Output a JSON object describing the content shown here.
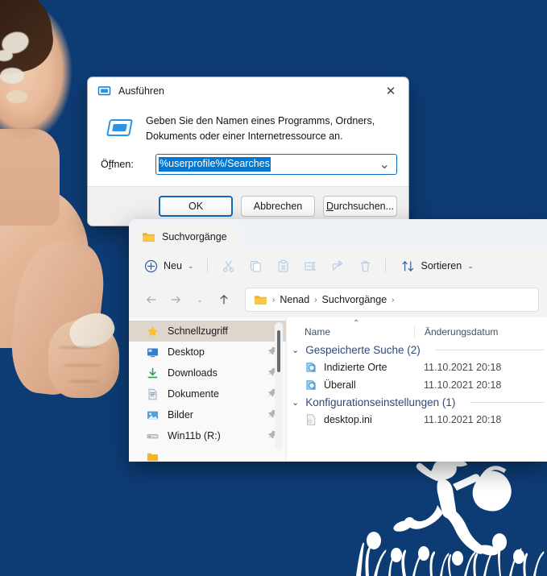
{
  "desktop": {
    "background_color": "#0d3c75",
    "photo_alt": "woman-with-face-mask-thumbs-up",
    "decoration_alt": "running-figure-with-basket-silhouette"
  },
  "run_dialog": {
    "title": "Ausführen",
    "title_icon": "run-window-icon",
    "close_label": "✕",
    "description": "Geben Sie den Namen eines Programms, Ordners, Dokuments oder einer Internetressource an.",
    "open_label_pre": "Ö",
    "open_label_accel": "f",
    "open_label_post": "fnen:",
    "combo_value": "%userprofile%/Searches",
    "combo_caret": "⌄",
    "selection_color": "#0078d4",
    "buttons": {
      "ok": "OK",
      "cancel": "Abbrechen",
      "browse_accel": "D",
      "browse_rest": "urchsuchen..."
    }
  },
  "explorer": {
    "tab": {
      "title": "Suchvorgänge",
      "icon": "folder-icon"
    },
    "toolbar": {
      "new_label": "Neu",
      "new_icon": "plus-circle-icon",
      "new_caret": "⌄",
      "icons": [
        {
          "name": "cut-icon",
          "label": "Ausschneiden",
          "disabled": true
        },
        {
          "name": "copy-icon",
          "label": "Kopieren",
          "disabled": true
        },
        {
          "name": "paste-icon",
          "label": "Einfügen",
          "disabled": true
        },
        {
          "name": "rename-icon",
          "label": "Umbenennen",
          "disabled": true
        },
        {
          "name": "share-icon",
          "label": "Freigeben",
          "disabled": true
        },
        {
          "name": "delete-icon",
          "label": "Löschen",
          "disabled": true
        }
      ],
      "sort_label": "Sortieren",
      "sort_icon": "sort-arrows-icon",
      "sort_caret": "⌄"
    },
    "address": {
      "back_icon": "arrow-left-icon",
      "forward_icon": "arrow-right-icon",
      "history_caret": "⌄",
      "up_icon": "arrow-up-icon",
      "crumb_icon": "folder-icon",
      "separator": "›",
      "crumbs": [
        "Nenad",
        "Suchvorgänge"
      ]
    },
    "sidebar": {
      "items": [
        {
          "label": "Schnellzugriff",
          "icon": "star-icon",
          "selected": true,
          "pinned": false
        },
        {
          "label": "Desktop",
          "icon": "desktop-icon",
          "selected": false,
          "pinned": true
        },
        {
          "label": "Downloads",
          "icon": "download-icon",
          "selected": false,
          "pinned": true
        },
        {
          "label": "Dokumente",
          "icon": "document-icon",
          "selected": false,
          "pinned": true
        },
        {
          "label": "Bilder",
          "icon": "pictures-icon",
          "selected": false,
          "pinned": true
        },
        {
          "label": "Win11b (R:)",
          "icon": "drive-icon",
          "selected": false,
          "pinned": true
        }
      ],
      "pin_glyph": "📌"
    },
    "list": {
      "columns": [
        "Name",
        "Änderungsdatum"
      ],
      "sort_indicator": "⌃",
      "groups": [
        {
          "title": "Gespeicherte Suche (2)",
          "chevron": "⌄",
          "rows": [
            {
              "name": "Indizierte Orte",
              "date": "11.10.2021 20:18",
              "icon": "saved-search-icon"
            },
            {
              "name": "Überall",
              "date": "11.10.2021 20:18",
              "icon": "saved-search-icon"
            }
          ]
        },
        {
          "title": "Konfigurationseinstellungen (1)",
          "chevron": "⌄",
          "rows": [
            {
              "name": "desktop.ini",
              "date": "11.10.2021 20:18",
              "icon": "ini-file-icon"
            }
          ]
        }
      ]
    }
  }
}
